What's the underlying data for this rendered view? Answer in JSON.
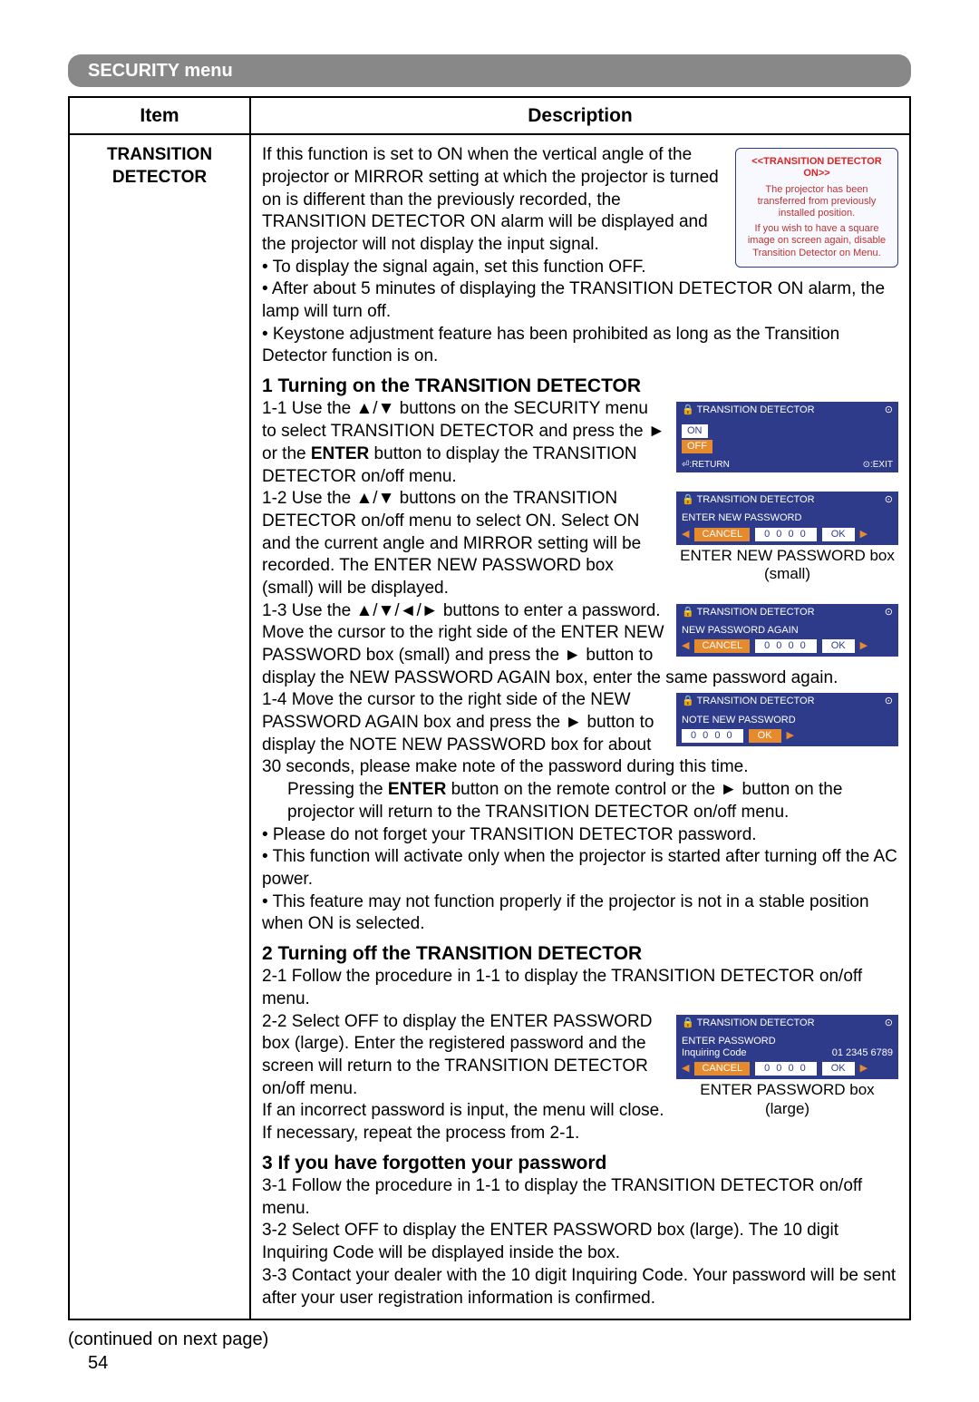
{
  "menu_title": "SECURITY menu",
  "headers": {
    "item": "Item",
    "description": "Description"
  },
  "item_name_l1": "TRANSITION",
  "item_name_l2": "DETECTOR",
  "intro": {
    "p1": "If this function is set to ON when the vertical angle of the projector or MIRROR setting at which the projector is turned on is different than the previously recorded, the TRANSITION DETECTOR ON alarm will be displayed and the projector will not display the input signal.",
    "b1": "• To display the signal again, set this function OFF.",
    "b2": "• After about 5 minutes of displaying the TRANSITION DETECTOR ON alarm, the lamp will turn off.",
    "b3": "• Keystone adjustment feature has been prohibited as long as the Transition Detector function is on."
  },
  "alarm": {
    "title": "<<TRANSITION DETECTOR ON>>",
    "l1": "The projector has been transferred from previously installed position.",
    "l2": "If you wish to have a square image on screen again, disable Transition Detector on Menu."
  },
  "sec1": {
    "head": "1 Turning on the TRANSITION DETECTOR",
    "s11a": "1-1 Use the ▲/▼ buttons on the SECURITY menu to select TRANSITION DETECTOR and press the ► or the ",
    "s11b": " button to display the TRANSITION DETECTOR on/off menu.",
    "enter": "ENTER",
    "s12": "1-2 Use the ▲/▼ buttons on the TRANSITION DETECTOR on/off menu to select ON. Select ON and the current angle and MIRROR setting will be recorded. The ENTER NEW PASSWORD box (small) will be displayed.",
    "s13": "1-3 Use the ▲/▼/◄/► buttons to enter a password. Move the cursor to the right side of the ENTER NEW PASSWORD box (small) and press the ► button to display the NEW PASSWORD AGAIN box, enter the same password again.",
    "s14a": "1-4 Move the cursor to the right side of the NEW PASSWORD AGAIN box and press the ► button to display the NOTE NEW PASSWORD box for about 30 seconds, please make note of the password during this time.",
    "s14b_a": "Pressing the ",
    "s14b_b": " button on the remote control or the ► button on the projector will return to the TRANSITION DETECTOR on/off menu.",
    "n1": "• Please do not forget your TRANSITION DETECTOR password.",
    "n2": "• This function will activate only when the projector is started after turning off the AC power.",
    "n3": "• This feature may not function properly if the projector is not in a stable position when ON is selected."
  },
  "sec2": {
    "head": "2 Turning off the TRANSITION DETECTOR",
    "s21": "2-1 Follow the procedure in 1-1 to display the TRANSITION DETECTOR on/off menu.",
    "s22": "2-2 Select OFF to display the ENTER PASSWORD box (large). Enter the registered password and the screen will return to the TRANSITION DETECTOR on/off menu.",
    "tail": "If an incorrect password is input, the menu will close. If necessary, repeat the process from 2-1."
  },
  "sec3": {
    "head": "3 If you have forgotten your password",
    "s31": "3-1 Follow the procedure in 1-1 to display the TRANSITION DETECTOR on/off menu.",
    "s32": "3-2 Select OFF to display the ENTER PASSWORD box (large). The 10 digit Inquiring Code will be displayed inside the box.",
    "s33": "3-3 Contact your dealer with the 10 digit Inquiring Code. Your password will be sent after your user registration information is confirmed."
  },
  "shots": {
    "title": "TRANSITION DETECTOR",
    "on": "ON",
    "off": "OFF",
    "return": "⏎:RETURN",
    "exit": "⊙:EXIT",
    "enp": "ENTER NEW PASSWORD",
    "npa": "NEW PASSWORD AGAIN",
    "nnp": "NOTE NEW PASSWORD",
    "ep": "ENTER PASSWORD",
    "inq_l": "Inquiring Code",
    "inq_v": "01 2345 6789",
    "cancel": "CANCEL",
    "d4": "0 0 0 0",
    "ok": "OK",
    "cap_enp": "ENTER NEW PASSWORD box (small)",
    "cap_ep": "ENTER PASSWORD box (large)"
  },
  "continued": "(continued on next page)",
  "page": "54"
}
